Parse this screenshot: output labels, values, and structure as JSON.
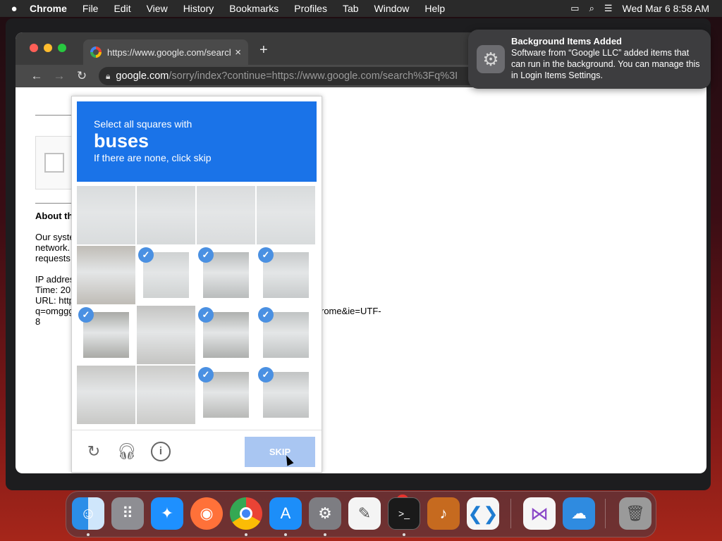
{
  "menubar": {
    "app": "Chrome",
    "menus": [
      "File",
      "Edit",
      "View",
      "History",
      "Bookmarks",
      "Profiles",
      "Tab",
      "Window",
      "Help"
    ],
    "datetime": "Wed Mar 6  8:58 AM",
    "icons": [
      "apple-icon",
      "screen-mirroring-icon",
      "search-icon",
      "control-center-icon"
    ]
  },
  "browser": {
    "tab_title": "https://www.google.com/search",
    "tab_close": "×",
    "new_tab": "+",
    "url_domain": "google.com",
    "url_path": "/sorry/index?continue=https://www.google.com/search%3Fq%3I"
  },
  "page": {
    "about": "About th",
    "line1": "Our syste",
    "line2": "network.",
    "line3": "requests",
    "ip": "IP addres",
    "time": "Time: 20",
    "url": "URL: http",
    "q": "q=omggg",
    "tail": "rome&ie=UTF-",
    "tail2": "8"
  },
  "captcha": {
    "instruction": "Select all squares with",
    "target": "buses",
    "hint": "If there are none, click skip",
    "skip_label": "SKIP",
    "tiles_selected": [
      [
        false,
        false,
        false,
        false
      ],
      [
        false,
        true,
        true,
        true
      ],
      [
        true,
        false,
        true,
        true
      ],
      [
        false,
        false,
        true,
        true
      ]
    ],
    "footer_icons": [
      "reload-icon",
      "audio-icon",
      "info-icon"
    ]
  },
  "notification": {
    "title": "Background Items Added",
    "body": "Software from “Google LLC” added items that can run in the background. You can manage this in Login Items Settings."
  },
  "dock": {
    "apps": [
      "Finder",
      "Launchpad",
      "Safari",
      "Firefox",
      "Chrome",
      "App Store",
      "System Settings",
      "TextEdit",
      "Terminal",
      "GarageBand",
      "VS Code",
      "Visual Studio",
      "Weather",
      "Trash"
    ],
    "settings_badge": "2"
  },
  "colors": {
    "captcha_blue": "#1a73e8",
    "skip_disabled": "#a9c6f2",
    "check_blue": "#4a90e2"
  }
}
